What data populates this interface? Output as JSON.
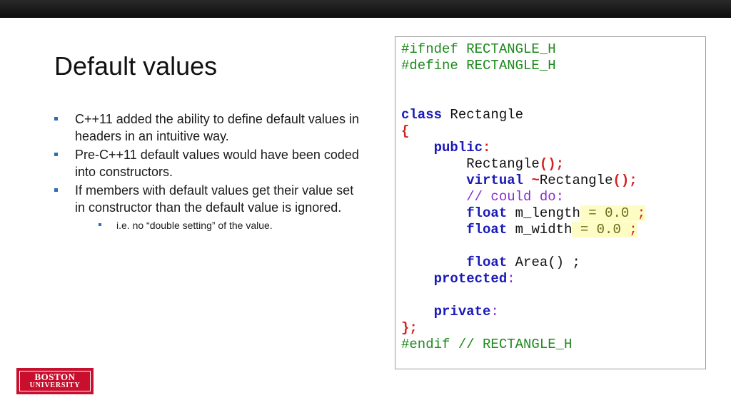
{
  "slide": {
    "title": "Default values",
    "bullets": [
      "C++11 added the ability to define default values in headers in an intuitive way.",
      "Pre-C++11 default values would have been coded into constructors.",
      "If members with default values get their value set in constructor than the default value is ignored."
    ],
    "sub_bullets": [
      "i.e. no “double setting” of the value."
    ]
  },
  "code": {
    "ifndef": "#ifndef RECTANGLE_H",
    "define": "#define RECTANGLE_H",
    "class_kw": "class",
    "class_name": " Rectangle",
    "open_brace": "{",
    "public_kw": "public",
    "colon": ":",
    "ctor_name": "Rectangle",
    "parens_semi": "();",
    "virtual_kw": "virtual",
    "tilde": "~",
    "dtor_name": "Rectangle",
    "comment": "// could do:",
    "float_kw": "float",
    "m_length": " m_length",
    "m_width": " m_width",
    "default_value": " = 0.0 ",
    "semicolon": ";",
    "area_decl": " Area() ;",
    "protected_kw": "protected",
    "private_kw": "private",
    "close_brace": "};",
    "endif": "#endif // RECTANGLE_H"
  },
  "logo": {
    "line1": "BOSTON",
    "line2": "UNIVERSITY"
  },
  "colors": {
    "keyword": "#1a1ab8",
    "preprocessor": "#1c8a1c",
    "punctuation": "#d42020",
    "comment": "#8a2bd1",
    "highlight": "#fdfcc4",
    "bullet": "#2f6eb5",
    "logo_red": "#c8102e"
  }
}
